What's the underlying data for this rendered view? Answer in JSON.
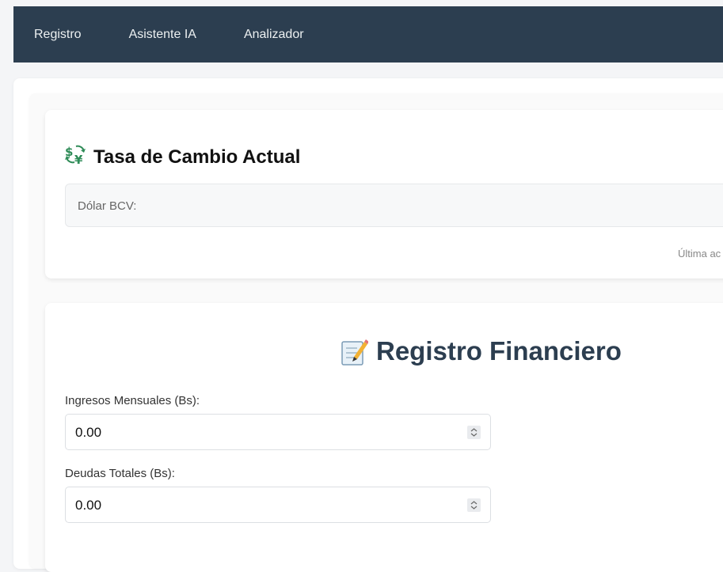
{
  "nav": {
    "items": [
      {
        "label": "Registro"
      },
      {
        "label": "Asistente IA"
      },
      {
        "label": "Analizador"
      }
    ]
  },
  "rate_card": {
    "icon": "currency-exchange-icon",
    "title": "Tasa de Cambio Actual",
    "dolar_label": "Dólar BCV:",
    "updated_text": "Última ac"
  },
  "register_card": {
    "icon": "memo-icon",
    "title": "Registro Financiero",
    "fields": [
      {
        "label": "Ingresos Mensuales (Bs):",
        "value": "0.00"
      },
      {
        "label": "Deudas Totales (Bs):",
        "value": "0.00"
      }
    ]
  },
  "colors": {
    "navbar": "#2c3e50",
    "title_dark": "#2c3e50"
  }
}
